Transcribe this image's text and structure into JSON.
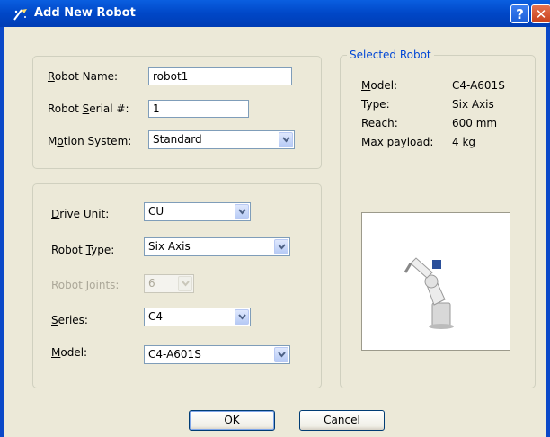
{
  "window": {
    "title": "Add New Robot",
    "help_glyph": "?",
    "close_glyph": "✕"
  },
  "robot_group": {
    "name_label_mn": "R",
    "name_label_rest": "obot Name:",
    "name_value": "robot1",
    "serial_label_pre": "Robot ",
    "serial_label_mn": "S",
    "serial_label_rest": "erial #:",
    "serial_value": "1",
    "motion_label_pre": "M",
    "motion_label_mn": "o",
    "motion_label_rest": "tion System:",
    "motion_value": "Standard"
  },
  "drive_group": {
    "drive_label_mn": "D",
    "drive_label_rest": "rive Unit:",
    "drive_value": "CU",
    "type_label_pre": "Robot ",
    "type_label_mn": "T",
    "type_label_rest": "ype:",
    "type_value": "Six Axis",
    "joints_label_pre": "Robot ",
    "joints_label_mn": "J",
    "joints_label_rest": "oints:",
    "joints_value": "6",
    "series_label_mn": "S",
    "series_label_rest": "eries:",
    "series_value": "C4",
    "model_label_mn": "M",
    "model_label_rest": "odel:",
    "model_value": "C4-A601S"
  },
  "selected_robot": {
    "legend": "Selected Robot",
    "model_label_mn": "M",
    "model_label_rest": "odel:",
    "model_value": "C4-A601S",
    "type_label": "Type:",
    "type_value": "Six Axis",
    "reach_label": "Reach:",
    "reach_value": "600 mm",
    "payload_label": "Max payload:",
    "payload_value": "4 kg",
    "image": "robot-arm-image"
  },
  "buttons": {
    "ok": "OK",
    "cancel": "Cancel"
  },
  "colors": {
    "titlebar": "#0a5fe0",
    "legend": "#0046d5",
    "dialog_bg": "#ece9d8"
  }
}
